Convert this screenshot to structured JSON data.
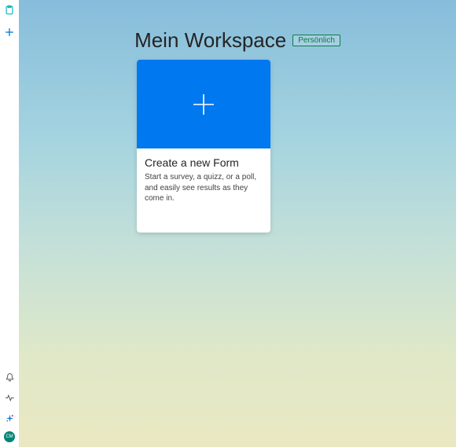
{
  "header": {
    "title": "Mein Workspace",
    "badge": "Persönlich"
  },
  "sidebar": {
    "top_icons": [
      "clipboard-icon",
      "plus-icon"
    ],
    "bottom_icons": [
      "bell-icon",
      "activity-icon",
      "sparkle-icon"
    ],
    "avatar_initials": "CM"
  },
  "card": {
    "title": "Create a new Form",
    "description": "Start a survey, a quizz, or a poll, and easily see results as they come in."
  }
}
